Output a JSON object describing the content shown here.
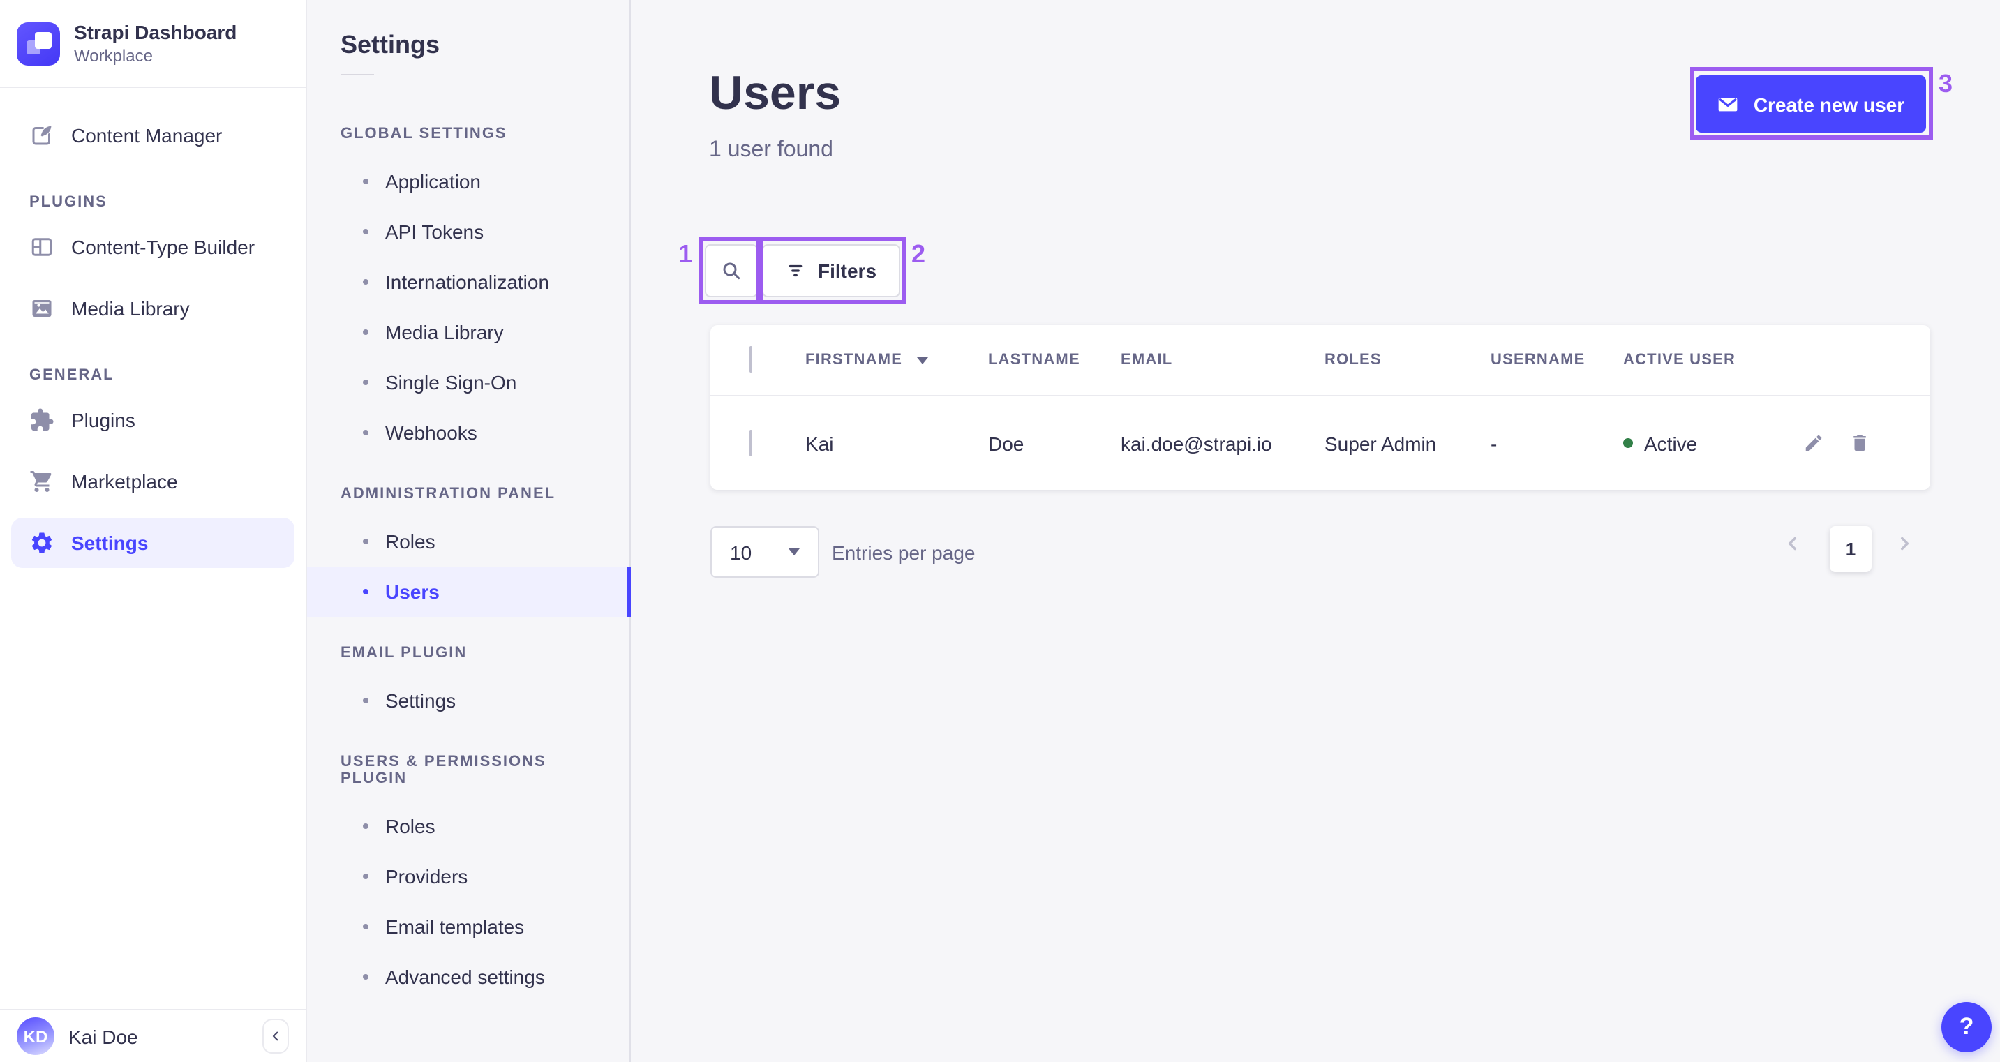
{
  "app": {
    "title": "Strapi Dashboard",
    "workspace": "Workplace"
  },
  "nav": {
    "content_manager": "Content Manager",
    "sections": [
      {
        "title": "PLUGINS",
        "items": [
          "Content-Type Builder",
          "Media Library"
        ]
      },
      {
        "title": "GENERAL",
        "items": [
          "Plugins",
          "Marketplace",
          "Settings"
        ]
      }
    ],
    "active_item": "Settings",
    "user": {
      "initials": "KD",
      "name": "Kai Doe"
    }
  },
  "subnav": {
    "title": "Settings",
    "sections": [
      {
        "title": "GLOBAL SETTINGS",
        "items": [
          "Application",
          "API Tokens",
          "Internationalization",
          "Media Library",
          "Single Sign-On",
          "Webhooks"
        ]
      },
      {
        "title": "ADMINISTRATION PANEL",
        "items": [
          "Roles",
          "Users"
        ]
      },
      {
        "title": "EMAIL PLUGIN",
        "items": [
          "Settings"
        ]
      },
      {
        "title": "USERS & PERMISSIONS PLUGIN",
        "items": [
          "Roles",
          "Providers",
          "Email templates",
          "Advanced settings"
        ]
      }
    ],
    "active_item": "Users"
  },
  "main": {
    "title": "Users",
    "subtitle": "1 user found",
    "create_button": {
      "label": "Create new user"
    },
    "filters_button": {
      "label": "Filters"
    },
    "table": {
      "columns": [
        "FIRSTNAME",
        "LASTNAME",
        "EMAIL",
        "ROLES",
        "USERNAME",
        "ACTIVE USER"
      ],
      "rows": [
        {
          "firstname": "Kai",
          "lastname": "Doe",
          "email": "kai.doe@strapi.io",
          "roles": "Super Admin",
          "username": "-",
          "status": "Active"
        }
      ]
    },
    "pagination": {
      "page_size": "10",
      "label": "Entries per page",
      "current_page": "1"
    }
  },
  "help_button": {
    "label": "?"
  },
  "annotations": {
    "marks": [
      "1",
      "2",
      "3"
    ]
  },
  "colors": {
    "primary": "#4945ff",
    "primary_bg": "#f0f0ff",
    "annotation": "#9c5cf0",
    "success": "#328048",
    "text": "#32324d",
    "text_muted": "#666687"
  }
}
